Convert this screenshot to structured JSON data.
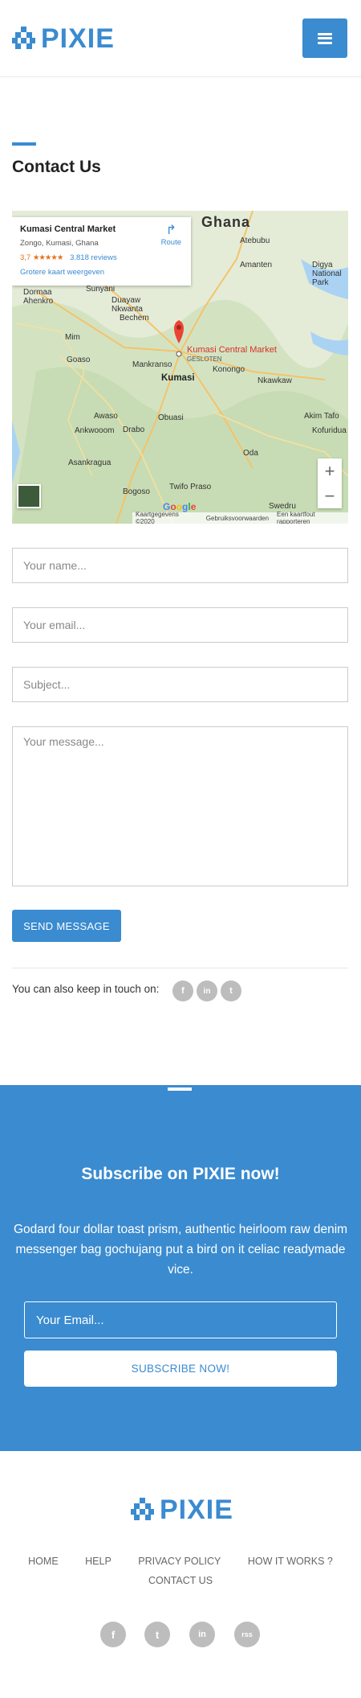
{
  "header": {
    "logo_text": "PIXIE",
    "menu_icon": "hamburger-icon"
  },
  "contact": {
    "title": "Contact Us",
    "map": {
      "place_name": "Kumasi Central Market",
      "address": "Zongo, Kumasi, Ghana",
      "rating": "3,7",
      "stars": "★★★★★",
      "reviews": "3.818 reviews",
      "bigger_map": "Grotere kaart weergeven",
      "route": "Route",
      "pin_label": "Kumasi Central Market",
      "pin_status": "GESLOTEN",
      "city_kumasi": "Kumasi",
      "country": "Ghana",
      "cities": [
        "Sunyani",
        "Duayaw Nkwanta",
        "Bechem",
        "Mim",
        "Goaso",
        "Ankwooom",
        "Asankragua",
        "Awaso",
        "Drabo",
        "Bogoso",
        "Obuasi",
        "Oda",
        "Akim Tafo",
        "Kofuridua",
        "Atebubu",
        "Amanten",
        "Konongo",
        "Nkawkaw",
        "Twifo Praso",
        "Swedru",
        "Mankranso",
        "Dormaa Ahenkro",
        "Digya National Park"
      ],
      "zoom_in": "+",
      "zoom_out": "−",
      "google": "Google",
      "footer_data": "Kaartgegevens ©2020",
      "footer_terms": "Gebruiksvoorwaarden",
      "footer_report": "Een kaartfout rapporteren"
    },
    "form": {
      "name_placeholder": "Your name...",
      "email_placeholder": "Your email...",
      "subject_placeholder": "Subject...",
      "message_placeholder": "Your message...",
      "send_label": "SEND MESSAGE"
    },
    "touch_text": "You can also keep in touch on:",
    "social_small": [
      "f",
      "in",
      "t"
    ]
  },
  "subscribe": {
    "title": "Subscribe on PIXIE now!",
    "text": "Godard four dollar toast prism, authentic heirloom raw denim messenger bag gochujang put a bird on it celiac readymade vice.",
    "email_placeholder": "Your Email...",
    "button_label": "SUBSCRIBE NOW!"
  },
  "footer": {
    "logo_text": "PIXIE",
    "nav": [
      "HOME",
      "HELP",
      "PRIVACY POLICY",
      "HOW IT WORKS ?",
      "CONTACT US"
    ],
    "social": [
      "f",
      "t",
      "in",
      "rss"
    ]
  },
  "colors": {
    "accent": "#3a8bd0",
    "gray_icon": "#bdbdbd"
  }
}
